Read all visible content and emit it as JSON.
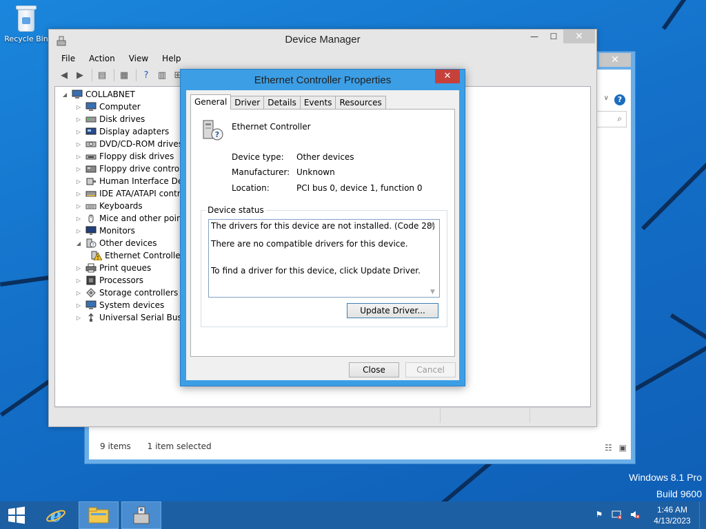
{
  "desktop": {
    "recycle_bin_label": "Recycle Bin",
    "brand_line1": "Windows 8.1 Pro",
    "brand_line2": "Build 9600"
  },
  "explorer": {
    "status_items": "9 items",
    "status_selected": "1 item selected"
  },
  "device_manager": {
    "title": "Device Manager",
    "menu": [
      "File",
      "Action",
      "View",
      "Help"
    ],
    "tree": {
      "root": "COLLABNET",
      "categories": [
        {
          "label": "Computer",
          "icon": "computer-icon"
        },
        {
          "label": "Disk drives",
          "icon": "disk-drive-icon"
        },
        {
          "label": "Display adapters",
          "icon": "display-adapter-icon"
        },
        {
          "label": "DVD/CD-ROM drives",
          "icon": "dvd-drive-icon"
        },
        {
          "label": "Floppy disk drives",
          "icon": "floppy-disk-icon"
        },
        {
          "label": "Floppy drive controller",
          "icon": "floppy-controller-icon"
        },
        {
          "label": "Human Interface Devic",
          "icon": "hid-icon"
        },
        {
          "label": "IDE ATA/ATAPI contro",
          "icon": "ide-controller-icon"
        },
        {
          "label": "Keyboards",
          "icon": "keyboard-icon"
        },
        {
          "label": "Mice and other pointin",
          "icon": "mouse-icon"
        },
        {
          "label": "Monitors",
          "icon": "monitor-icon"
        },
        {
          "label": "Other devices",
          "icon": "unknown-device-icon"
        },
        {
          "label": "Ethernet Controller",
          "icon": "warning-device-icon"
        },
        {
          "label": "Print queues",
          "icon": "printer-icon"
        },
        {
          "label": "Processors",
          "icon": "processor-icon"
        },
        {
          "label": "Storage controllers",
          "icon": "storage-controller-icon"
        },
        {
          "label": "System devices",
          "icon": "system-device-icon"
        },
        {
          "label": "Universal Serial Bus co",
          "icon": "usb-icon"
        }
      ]
    }
  },
  "properties": {
    "title": "Ethernet Controller Properties",
    "tabs": [
      "General",
      "Driver",
      "Details",
      "Events",
      "Resources"
    ],
    "device_name": "Ethernet Controller",
    "device_type_label": "Device type:",
    "device_type_value": "Other devices",
    "manufacturer_label": "Manufacturer:",
    "manufacturer_value": "Unknown",
    "location_label": "Location:",
    "location_value": "PCI bus 0, device 1, function 0",
    "status_group_label": "Device status",
    "status_line1": "The drivers for this device are not installed. (Code 28)",
    "status_line2": "There are no compatible drivers for this device.",
    "status_line3": "To find a driver for this device, click Update Driver.",
    "update_driver_label": "Update Driver...",
    "close_label": "Close",
    "cancel_label": "Cancel"
  },
  "taskbar": {
    "time": "1:46 AM",
    "date": "4/13/2023"
  },
  "colors": {
    "desktop_blue": "#1570c8",
    "dialog_frame": "#3c9ee5",
    "close_red": "#c7413b",
    "taskbar": "#1d5fa3"
  }
}
